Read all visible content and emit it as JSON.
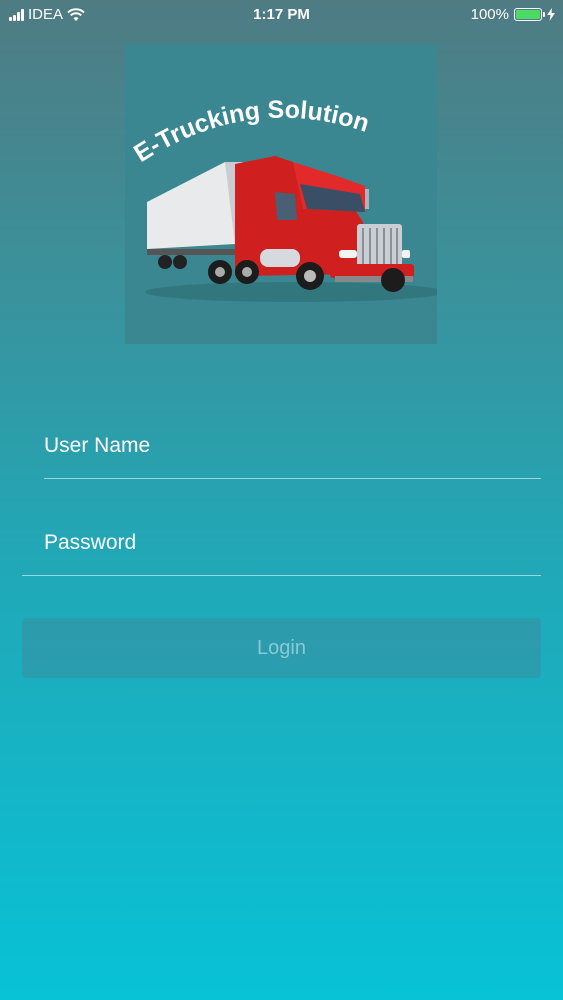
{
  "status_bar": {
    "carrier": "IDEA",
    "time": "1:17 PM",
    "battery_percent": "100%",
    "battery_level": 1.0,
    "battery_color": "#4cd964",
    "icons": [
      "signal-icon",
      "wifi-icon",
      "battery-icon",
      "charging-bolt-icon"
    ]
  },
  "logo": {
    "text": "E-Trucking Solution",
    "image": "red-truck-icon"
  },
  "form": {
    "username_placeholder": "User Name",
    "username_value": "",
    "password_placeholder": "Password",
    "password_value": "",
    "login_label": "Login"
  },
  "colors": {
    "gradient_top": "#4f7b83",
    "gradient_bottom": "#08c2d6",
    "truck_red": "#d01f1f"
  }
}
